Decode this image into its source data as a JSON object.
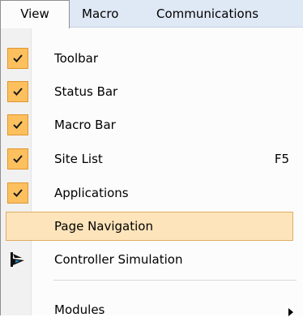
{
  "menubar": {
    "items": [
      {
        "label": "View"
      },
      {
        "label": "Macro"
      },
      {
        "label": "Communications"
      }
    ]
  },
  "menu": {
    "items": [
      {
        "label": "Toolbar",
        "checked": true
      },
      {
        "label": "Status Bar",
        "checked": true
      },
      {
        "label": "Macro Bar",
        "checked": true
      },
      {
        "label": "Site List",
        "checked": true,
        "shortcut": "F5"
      },
      {
        "label": "Applications",
        "checked": true
      },
      {
        "label": "Page Navigation",
        "checked": false,
        "highlighted": true
      },
      {
        "label": "Controller Simulation",
        "icon": "controller-simulation-icon"
      },
      {
        "label": "Modules",
        "submenu": true
      }
    ]
  },
  "colors": {
    "menubar_bg": "#dfe8f5",
    "check_bg": "#fdc05f",
    "highlight_bg": "#fde4bb"
  }
}
